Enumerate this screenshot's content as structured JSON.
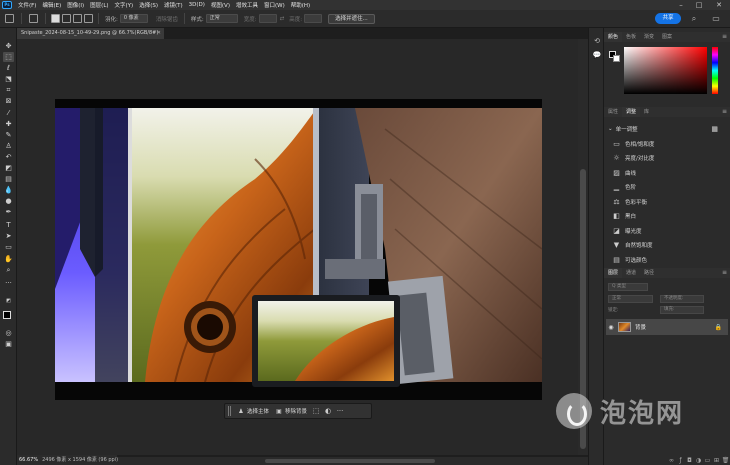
{
  "app": {
    "logo_text": "Ps"
  },
  "menu": [
    "文件(F)",
    "编辑(E)",
    "图像(I)",
    "图层(L)",
    "文字(Y)",
    "选择(S)",
    "滤镜(T)",
    "3D(D)",
    "视图(V)",
    "增效工具",
    "窗口(W)",
    "帮助(H)"
  ],
  "options": {
    "feather_label": "羽化:",
    "feather_value": "0 像素",
    "antialias_label": "消除锯齿",
    "style_label": "样式:",
    "style_value": "正常",
    "width_label": "宽度:",
    "height_label": "高度:",
    "select_mask_button": "选择并遮住...",
    "share_button": "共享"
  },
  "document": {
    "tab_title": "Snipaste_2024-08-15_10-49-29.png @ 66.7%(RGB/8#)",
    "zoom": "66.67%",
    "size_info": "2496 像素 x 1594 像素 (96 ppi)"
  },
  "taskbar": {
    "select_subject": "选择主体",
    "remove_bg": "移除背景"
  },
  "color_panel": {
    "tabs": [
      "颜色",
      "色板",
      "渐变",
      "图案"
    ],
    "foreground": "#000000",
    "background": "#ffffff"
  },
  "adjust_panel": {
    "tabs": [
      "属性",
      "调整",
      "库"
    ],
    "section": "单一调整",
    "items": [
      {
        "icon": "brightness-icon",
        "label": "色相/饱和度"
      },
      {
        "icon": "contrast-icon",
        "label": "亮度/对比度"
      },
      {
        "icon": "curves-icon",
        "label": "曲线"
      },
      {
        "icon": "levels-icon",
        "label": "色阶"
      },
      {
        "icon": "balance-icon",
        "label": "色彩平衡"
      },
      {
        "icon": "bw-icon",
        "label": "黑白"
      },
      {
        "icon": "exposure-icon",
        "label": "曝光度"
      },
      {
        "icon": "vibrance-icon",
        "label": "自然饱和度"
      },
      {
        "icon": "selective-color-icon",
        "label": "可选颜色"
      }
    ]
  },
  "layers_panel": {
    "tabs": [
      "图层",
      "通道",
      "路径"
    ],
    "kind_label": "Q 类型",
    "blend_mode": "正常",
    "opacity_label": "不透明度:",
    "lock_label": "锁定:",
    "fill_label": "填充:",
    "layer_name": "背景"
  },
  "watermark": {
    "text": "泡泡网"
  }
}
